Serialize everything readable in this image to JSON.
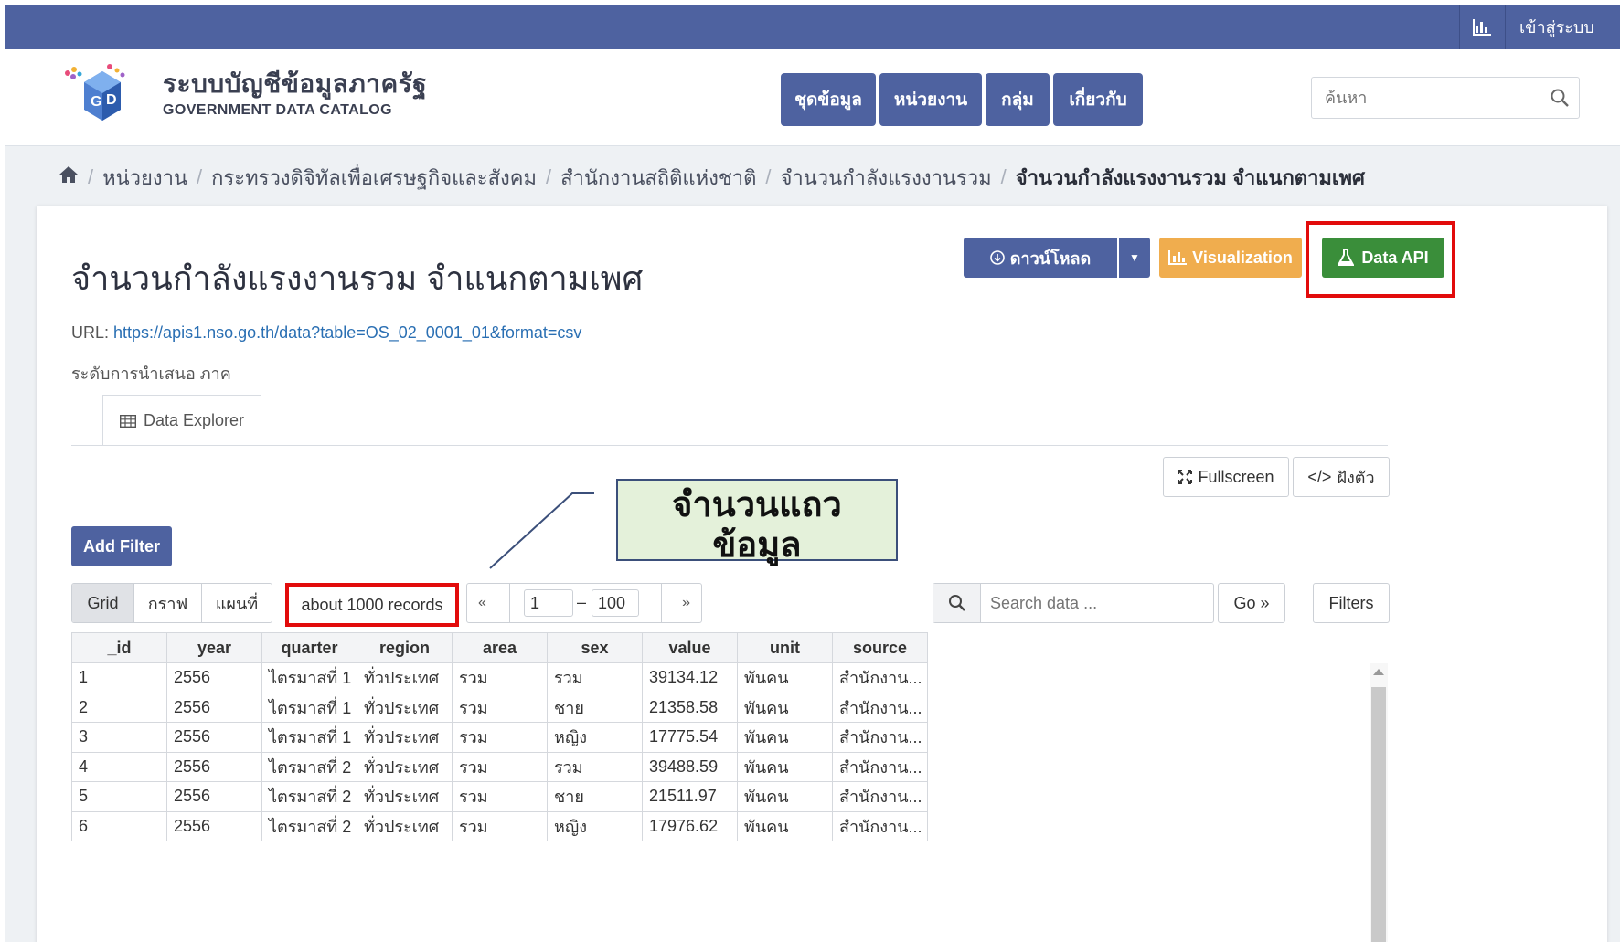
{
  "topbar": {
    "chart_icon": "bar-chart-icon",
    "login_label": "เข้าสู่ระบบ",
    "color": "#4e62a0"
  },
  "header": {
    "site_title": "ระบบบัญชีข้อมูลภาครัฐ",
    "site_subtitle": "GOVERNMENT DATA CATALOG",
    "nav": [
      "ชุดข้อมูล",
      "หน่วยงาน",
      "กลุ่ม",
      "เกี่ยวกับ"
    ],
    "search_placeholder": "ค้นหา"
  },
  "breadcrumb": {
    "home_icon": "home-icon",
    "items": [
      "หน่วยงาน",
      "กระทรวงดิจิทัลเพื่อเศรษฐกิจและสังคม",
      "สำนักงานสถิติแห่งชาติ",
      "จำนวนกำลังแรงงานรวม",
      "จำนวนกำลังแรงงานรวม จำแนกตามเพศ"
    ]
  },
  "resource": {
    "title": "จำนวนกำลังแรงงานรวม จำแนกตามเพศ",
    "url_label": "URL:",
    "url": "https://apis1.nso.go.th/data?table=OS_02_0001_01&format=csv",
    "level": "ระดับการนำเสนอ ภาค",
    "download_label": "ดาวน์โหลด",
    "visualization_label": "Visualization",
    "data_api_label": "Data API",
    "tab_label": "Data Explorer",
    "fullscreen_label": "Fullscreen",
    "embed_label": "ฝังตัว"
  },
  "callout": {
    "line1": "จำนวนแถว",
    "line2": "ข้อมูล"
  },
  "explorer": {
    "add_filter_label": "Add Filter",
    "views": [
      "Grid",
      "กราฟ",
      "แผนที่"
    ],
    "active_view": "Grid",
    "records_label": "about 1000 records",
    "pager_prev": "«",
    "pager_next": "»",
    "pager_from": "1",
    "pager_to": "100",
    "search_placeholder": "Search data ...",
    "go_label": "Go »",
    "filters_label": "Filters"
  },
  "table": {
    "columns": [
      "_id",
      "year",
      "quarter",
      "region",
      "area",
      "sex",
      "value",
      "unit",
      "source"
    ],
    "rows": [
      [
        "1",
        "2556",
        "ไตรมาสที่ 1",
        "ทั่วประเทศ",
        "รวม",
        "รวม",
        "39134.12",
        "พันคน",
        "สำนักงาน..."
      ],
      [
        "2",
        "2556",
        "ไตรมาสที่ 1",
        "ทั่วประเทศ",
        "รวม",
        "ชาย",
        "21358.58",
        "พันคน",
        "สำนักงาน..."
      ],
      [
        "3",
        "2556",
        "ไตรมาสที่ 1",
        "ทั่วประเทศ",
        "รวม",
        "หญิง",
        "17775.54",
        "พันคน",
        "สำนักงาน..."
      ],
      [
        "4",
        "2556",
        "ไตรมาสที่ 2",
        "ทั่วประเทศ",
        "รวม",
        "รวม",
        "39488.59",
        "พันคน",
        "สำนักงาน..."
      ],
      [
        "5",
        "2556",
        "ไตรมาสที่ 2",
        "ทั่วประเทศ",
        "รวม",
        "ชาย",
        "21511.97",
        "พันคน",
        "สำนักงาน..."
      ],
      [
        "6",
        "2556",
        "ไตรมาสที่ 2",
        "ทั่วประเทศ",
        "รวม",
        "หญิง",
        "17976.62",
        "พันคน",
        "สำนักงาน..."
      ]
    ]
  },
  "colors": {
    "primary": "#4e62a0",
    "warning": "#f0ad4e",
    "success": "#3a8e3a",
    "highlight": "#e20b0b",
    "callout_bg": "#e4f1da"
  }
}
